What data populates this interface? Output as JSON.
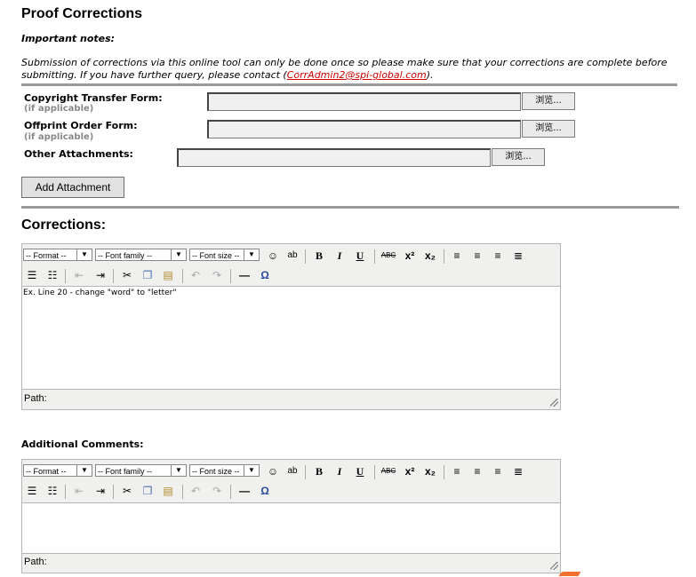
{
  "page_title": "Proof Corrections",
  "notes": {
    "heading": "Important notes:",
    "text_before": "Submission of corrections via this online tool can only be done once so please make sure that your corrections are complete before submitting. If you have further query, please contact (",
    "email": "CorrAdmin2@spi-global.com",
    "text_after": ")."
  },
  "attachments": {
    "copyright_label": "Copyright Transfer Form:",
    "copyright_sub": "(if applicable)",
    "offprint_label": "Offprint Order Form:",
    "offprint_sub": "(if applicable)",
    "other_label": "Other Attachments:",
    "browse_label": "浏览...",
    "add_button": "Add Attachment"
  },
  "corrections": {
    "heading": "Corrections:",
    "format_select": "-- Format --",
    "font_family_select": "-- Font family --",
    "font_size_select": "-- Font size --",
    "content": "Ex. Line 20 - change \"word\" to \"letter\"",
    "path_label": "Path:"
  },
  "comments": {
    "heading": "Additional Comments:",
    "format_select": "-- Format --",
    "font_family_select": "-- Font family --",
    "font_size_select": "-- Font size --",
    "content": "",
    "path_label": "Path:"
  },
  "toolbar": {
    "bold": "B",
    "italic": "I",
    "underline": "U",
    "spellcheck": "ABC",
    "omega": "Ω"
  },
  "colors": {
    "link": "#cc0000",
    "rule": "#9a9a9a",
    "editor_bg": "#f0f0ee"
  }
}
